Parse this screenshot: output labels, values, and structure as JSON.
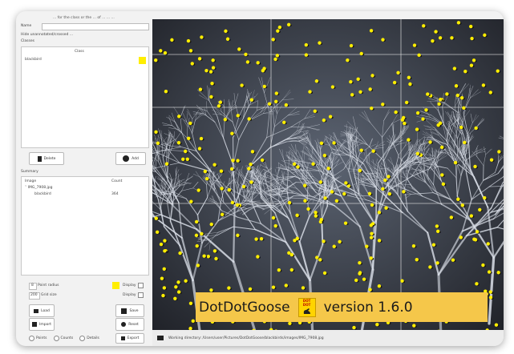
{
  "window": {
    "top_text": "... for the class or the ... of ... ... ..."
  },
  "left_panel": {
    "name_label": "Name",
    "name_value": "",
    "survey_label": "Hide unannotated/crossed ...",
    "classes_header": "Classes",
    "class_column_header": "Class",
    "classes": [
      {
        "name": "blackbird",
        "color": "#ffee00"
      }
    ],
    "delete_button": "Delete",
    "add_button": "Add",
    "summary_header": "Summary",
    "summary_columns": [
      "Image",
      "Count"
    ],
    "summary_rows": [
      {
        "label": "IMG_7908.jpg",
        "count": ""
      },
      {
        "label": "blackbird",
        "count": "364"
      }
    ],
    "point_radius_label": "Point radius",
    "point_radius_value": "8",
    "point_color_label": "Display",
    "grid_size_label": "Grid size",
    "grid_size_value": "200",
    "grid_display_label": "Display",
    "load_button": "Load",
    "save_button": "Save",
    "import_button": "Import",
    "reset_button": "Reset",
    "export_options": [
      "Points",
      "Counts",
      "Details"
    ],
    "export_button": "Export",
    "accent_color": "#ffee00"
  },
  "status": {
    "folder_icon": "folder-icon",
    "path_text": "Working directory: /Users/user/Pictures/DotDotGoose/blackbirds/images/IMG_7908.jpg"
  },
  "banner": {
    "app_name": "DotDotGoose",
    "logo_text_top": "DOT",
    "logo_text_bottom": "DOT",
    "version": "version 1.6.0"
  }
}
